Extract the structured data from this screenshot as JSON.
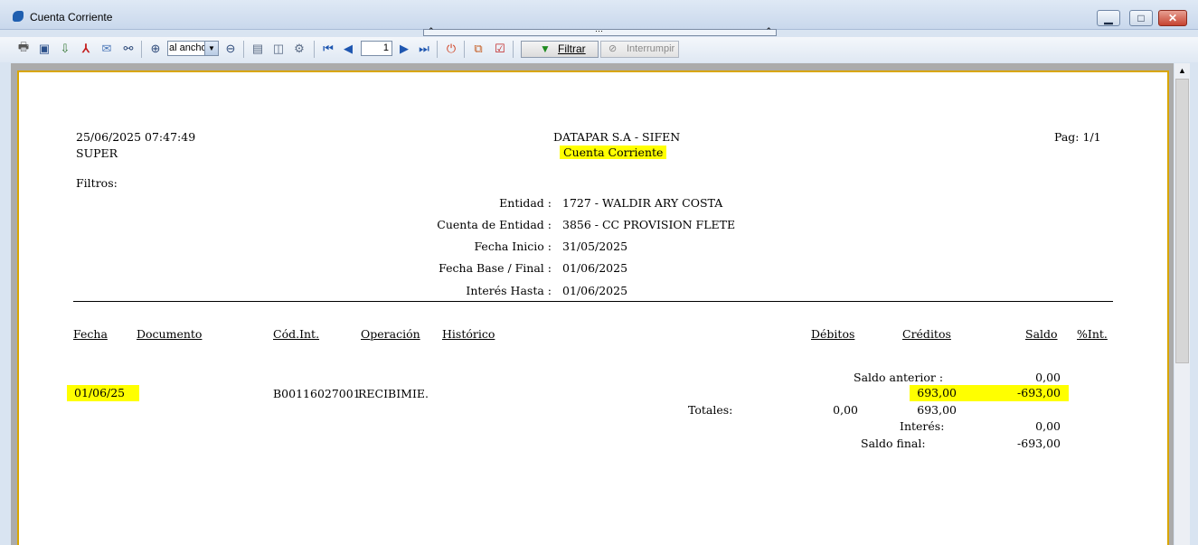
{
  "window": {
    "title": "Cuenta Corriente",
    "min_glyph": "▁",
    "max_glyph": "□",
    "close_glyph": "✕"
  },
  "toolbar": {
    "zoom_value": "al ancho",
    "page_value": "1",
    "filter_label": "Filtrar",
    "interrupt_label": "Interrumpir"
  },
  "report": {
    "datetime": "25/06/2025 07:47:49",
    "user": "SUPER",
    "company": "DATAPAR S.A - SIFEN",
    "title": "Cuenta Corriente",
    "page": "Pag: 1/1",
    "filters_label": "Filtros:",
    "filters": [
      {
        "label": "Entidad :",
        "value": "1727 - WALDIR ARY COSTA"
      },
      {
        "label": "Cuenta de Entidad :",
        "value": "3856 - CC PROVISION FLETE"
      },
      {
        "label": "Fecha Inicio :",
        "value": "31/05/2025"
      },
      {
        "label": "Fecha Base / Final :",
        "value": "01/06/2025"
      },
      {
        "label": "Interés Hasta :",
        "value": "01/06/2025"
      }
    ],
    "columns": {
      "fecha": "Fecha",
      "documento": "Documento",
      "cod_int": "Cód.Int.",
      "operacion": "Operación",
      "historico": "Histórico",
      "debitos": "Débitos",
      "creditos": "Créditos",
      "saldo": "Saldo",
      "pct_int": "%Int."
    },
    "saldo_anterior_label": "Saldo anterior :",
    "saldo_anterior_value": "0,00",
    "row": {
      "fecha": "01/06/25",
      "cod_int": "B00116027001",
      "operacion": "RECIBIMIE.",
      "creditos": "693,00",
      "saldo": "-693,00"
    },
    "totales_label": "Totales:",
    "totales_debitos": "0,00",
    "totales_creditos": "693,00",
    "interes_label": "Interés:",
    "interes_value": "0,00",
    "saldo_final_label": "Saldo final:",
    "saldo_final_value": "-693,00"
  }
}
